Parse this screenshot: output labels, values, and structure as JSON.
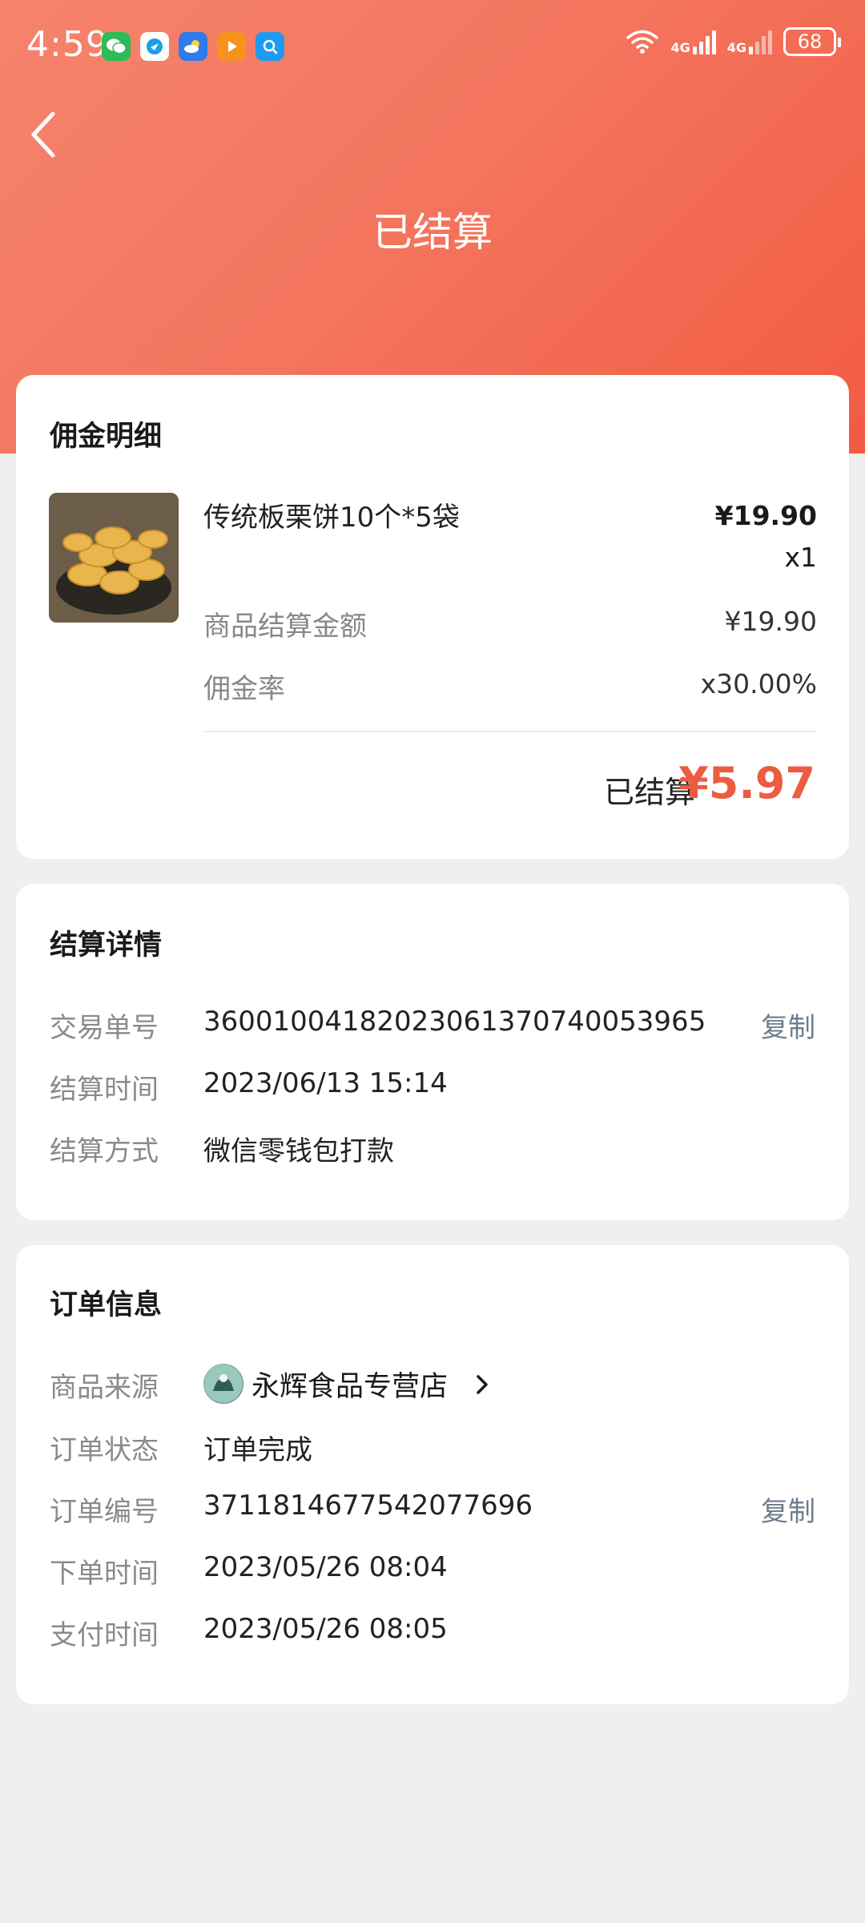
{
  "status_bar": {
    "time": "4:59",
    "app_icons": [
      "wechat-icon",
      "browser-icon",
      "weather-icon",
      "video-icon",
      "search-icon"
    ],
    "network": [
      "4G",
      "4G"
    ],
    "battery": "68"
  },
  "header": {
    "title": "已结算",
    "back_icon": "chevron-left-icon",
    "gradient_colors": [
      "#f6836c",
      "#f25b43"
    ]
  },
  "commission": {
    "title": "佣金明细",
    "product": {
      "name": "传统板栗饼10个*5袋",
      "price": "¥19.90",
      "quantity": "x1"
    },
    "rows": [
      {
        "label": "商品结算金额",
        "value": "¥19.90"
      },
      {
        "label": "佣金率",
        "value": "x30.00%"
      }
    ],
    "settled_label": "已结算",
    "settled_amount": "¥5.97",
    "accent_color": "#ed5b41"
  },
  "settlement": {
    "title": "结算详情",
    "rows": [
      {
        "label": "交易单号",
        "value": "3600100418202306137074005396​5",
        "action": "复制"
      },
      {
        "label": "结算时间",
        "value": "2023/06/13 15:14"
      },
      {
        "label": "结算方式",
        "value": "微信零钱包打款"
      }
    ]
  },
  "order": {
    "title": "订单信息",
    "shop_label": "商品来源",
    "shop_name": "永辉食品专营店",
    "rows": [
      {
        "label": "订单状态",
        "value": "订单完成"
      },
      {
        "label": "订单编号",
        "value": "3711814677542077696",
        "action": "复制"
      },
      {
        "label": "下单时间",
        "value": "2023/05/26 08:04"
      },
      {
        "label": "支付时间",
        "value": "2023/05/26 08:05"
      }
    ]
  }
}
